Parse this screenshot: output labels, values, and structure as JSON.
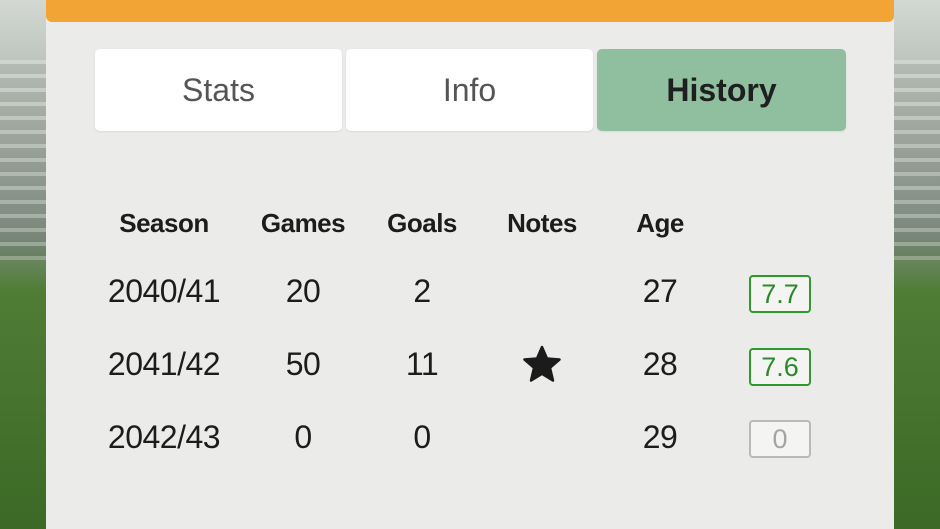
{
  "tabs": [
    {
      "label": "Stats",
      "active": false
    },
    {
      "label": "Info",
      "active": false
    },
    {
      "label": "History",
      "active": true
    }
  ],
  "colors": {
    "accent_bar": "#f2a534",
    "active_tab": "#8fbf9f",
    "rating_good": "#2e9a2e",
    "rating_none": "#b9b9b9"
  },
  "table": {
    "headers": [
      "Season",
      "Games",
      "Goals",
      "Notes",
      "Age"
    ],
    "rows": [
      {
        "season": "2040/41",
        "games": "20",
        "goals": "2",
        "note_icon": "",
        "age": "27",
        "rating": "7.7"
      },
      {
        "season": "2041/42",
        "games": "50",
        "goals": "11",
        "note_icon": "star-icon",
        "age": "28",
        "rating": "7.6"
      },
      {
        "season": "2042/43",
        "games": "0",
        "goals": "0",
        "note_icon": "",
        "age": "29",
        "rating": "0"
      }
    ]
  }
}
